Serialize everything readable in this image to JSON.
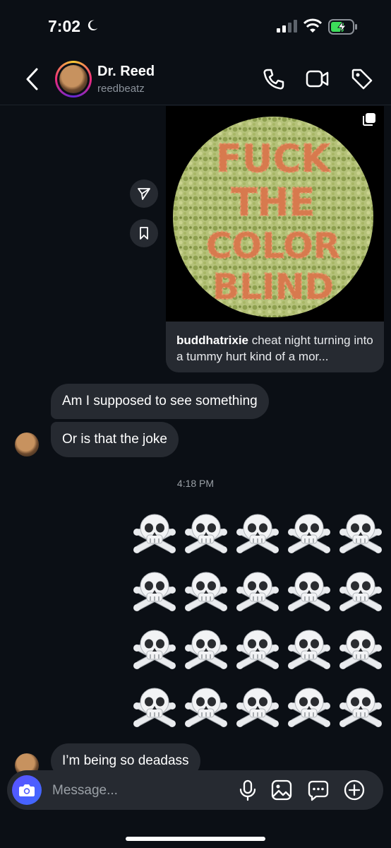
{
  "status_bar": {
    "time": "7:02"
  },
  "header": {
    "name": "Dr. Reed",
    "username": "reedbeatz"
  },
  "shared_post": {
    "image_text": [
      "FUCK",
      "THE",
      "COLOR",
      "BLIND"
    ],
    "caption_user": "buddhatrixie",
    "caption_text": " cheat night turning into a tummy hurt kind of a mor..."
  },
  "messages": [
    {
      "text": "Am I supposed to see something",
      "from": "them"
    },
    {
      "text": "Or is that the joke",
      "from": "them"
    }
  ],
  "timestamp": "4:18 PM",
  "emoji_message": {
    "emoji": "skull-and-crossbones",
    "rows": 4,
    "cols": 5
  },
  "last_message": {
    "text": "I’m being so deadass",
    "from": "them"
  },
  "composer": {
    "placeholder": "Message..."
  },
  "colors": {
    "background": "#0b0f15",
    "bubble": "#262a31",
    "accent": "#4f5bff"
  }
}
